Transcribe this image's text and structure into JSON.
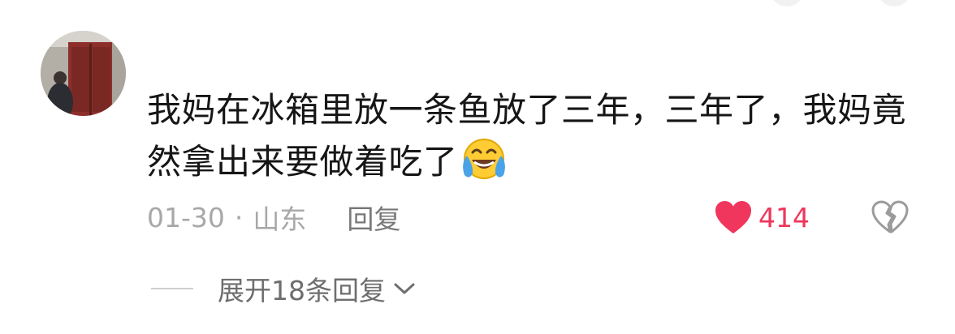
{
  "comment": {
    "text": "我妈在冰箱里放一条鱼放了三年，三年了，我妈竟然拿出来要做着吃了",
    "emoji": "crying-laughing-emoji",
    "date": "01-30",
    "separator": "·",
    "location": "山东",
    "reply_label": "回复",
    "likes": "414",
    "expand_replies_label": "展开18条回复"
  },
  "colors": {
    "like": "#f0365c",
    "text": "#161616",
    "meta": "#a8a8a8"
  }
}
